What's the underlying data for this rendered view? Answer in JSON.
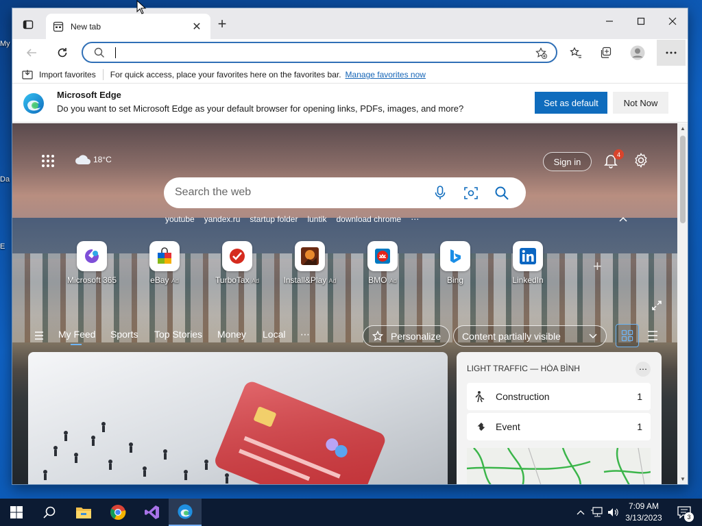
{
  "browser": {
    "tab_title": "New tab",
    "favbar": {
      "import_label": "Import favorites",
      "hint": "For quick access, place your favorites here on the favorites bar.",
      "manage_link": "Manage favorites now"
    },
    "infobar": {
      "title": "Microsoft Edge",
      "message": "Do you want to set Microsoft Edge as your default browser for opening links, PDFs, images, and more?",
      "primary": "Set as default",
      "secondary": "Not Now"
    }
  },
  "newtab": {
    "weather": "18°C",
    "sign_in": "Sign in",
    "notif_count": "4",
    "search_placeholder": "Search the web",
    "quick_links": [
      "youtube",
      "yandex.ru",
      "startup folder",
      "luntik",
      "download chrome"
    ],
    "tiles": [
      {
        "label": "Microsoft 365",
        "ad": ""
      },
      {
        "label": "eBay",
        "ad": "Ad"
      },
      {
        "label": "TurboTax",
        "ad": "Ad"
      },
      {
        "label": "Install&Play",
        "ad": "Ad"
      },
      {
        "label": "BMO",
        "ad": "Ad"
      },
      {
        "label": "Bing",
        "ad": ""
      },
      {
        "label": "LinkedIn",
        "ad": ""
      }
    ],
    "feed_tabs": [
      "My Feed",
      "Sports",
      "Top Stories",
      "Money",
      "Local"
    ],
    "personalize": "Personalize",
    "content_visibility": "Content partially visible",
    "traffic": {
      "title": "LIGHT TRAFFIC — HÒA BÌNH",
      "rows": [
        {
          "label": "Construction",
          "count": "1"
        },
        {
          "label": "Event",
          "count": "1"
        }
      ]
    }
  },
  "taskbar": {
    "time": "7:09 AM",
    "date": "3/13/2023",
    "notif_count": "3"
  },
  "colors": {
    "accent": "#0f6cbd",
    "taskbar": "#0c1b33"
  }
}
